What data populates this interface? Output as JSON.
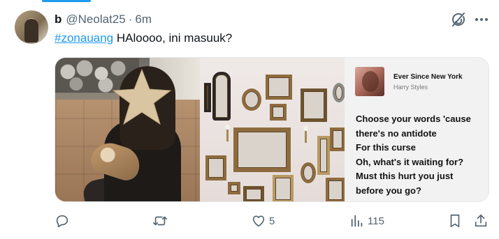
{
  "author": {
    "name": "b",
    "handle": "@Neolat25",
    "separator": "·",
    "time": "6m"
  },
  "tweet": {
    "hashtag": "#zonauang",
    "text": " HAloooo, ini masuuk?"
  },
  "lyrics_card": {
    "song_title": "Ever Since New York",
    "artist": "Harry Styles",
    "lines": [
      "Choose your words 'cause",
      "there's no antidote",
      "For this curse",
      "Oh, what's it waiting for?",
      "Must this hurt you just",
      "before you go?"
    ]
  },
  "actions": {
    "reply_count": "",
    "retweet_count": "",
    "like_count": "5",
    "views_count": "115"
  },
  "icons": {
    "grok": "grok-icon",
    "more": "more-icon",
    "reply": "reply-icon",
    "retweet": "retweet-icon",
    "like": "heart-icon",
    "views": "views-icon",
    "bookmark": "bookmark-icon",
    "share": "share-icon"
  },
  "colors": {
    "accent": "#1d9bf0",
    "text": "#0f1419",
    "muted": "#536471"
  }
}
